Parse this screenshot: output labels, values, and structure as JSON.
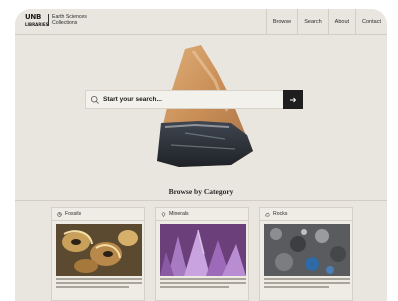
{
  "header": {
    "logo_line1": "UNB",
    "logo_line2": "LIBRARIES",
    "site_title_line1": "Earth Sciences",
    "site_title_line2": "Collections",
    "nav": [
      "Browse",
      "Search",
      "About",
      "Contact"
    ]
  },
  "hero": {
    "search_placeholder": "Start your search..."
  },
  "browse": {
    "title": "Browse by Category",
    "categories": [
      {
        "label": "Fossils",
        "icon": "fossil-icon"
      },
      {
        "label": "Minerals",
        "icon": "crystal-icon"
      },
      {
        "label": "Rocks",
        "icon": "rock-icon"
      }
    ]
  },
  "colors": {
    "background": "#e9e6df",
    "accent_dark": "#1e1e1e"
  }
}
